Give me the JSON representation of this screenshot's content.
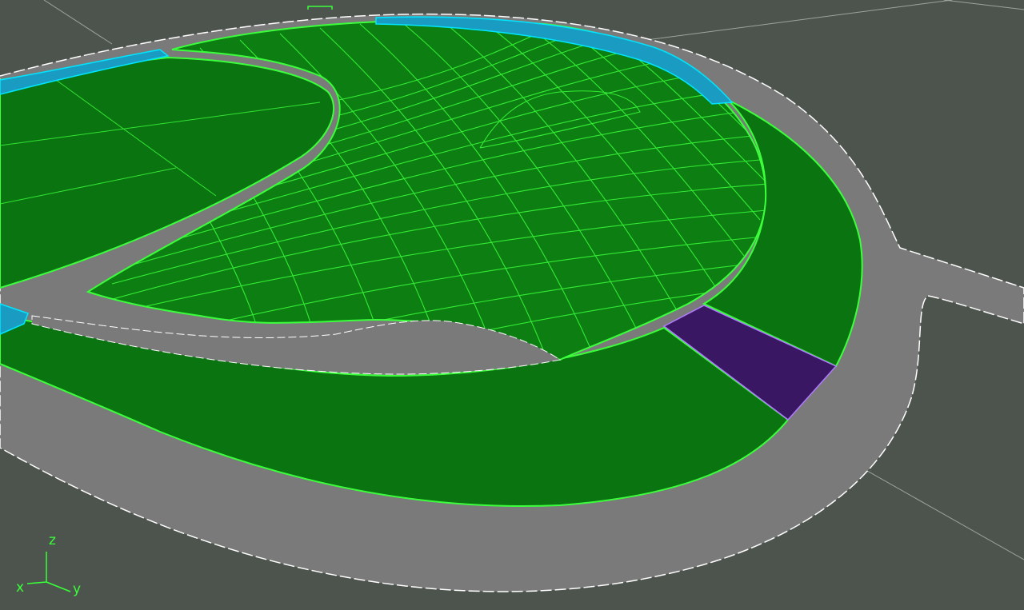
{
  "viewport": {
    "background_color": "#4d544d",
    "colors": {
      "road": "#7a7a7a",
      "grass": "#0a7410",
      "grass_edge": "#3cff3c",
      "selected_blue": "#1a9cc2",
      "purple_patch": "#3a1763",
      "outline_white": "#ffffff",
      "guide_line": "#c8c8c8"
    }
  },
  "axis_gizmo": {
    "labels": {
      "z": "z",
      "x": "x",
      "y": "y"
    },
    "color": "#39ff39"
  }
}
